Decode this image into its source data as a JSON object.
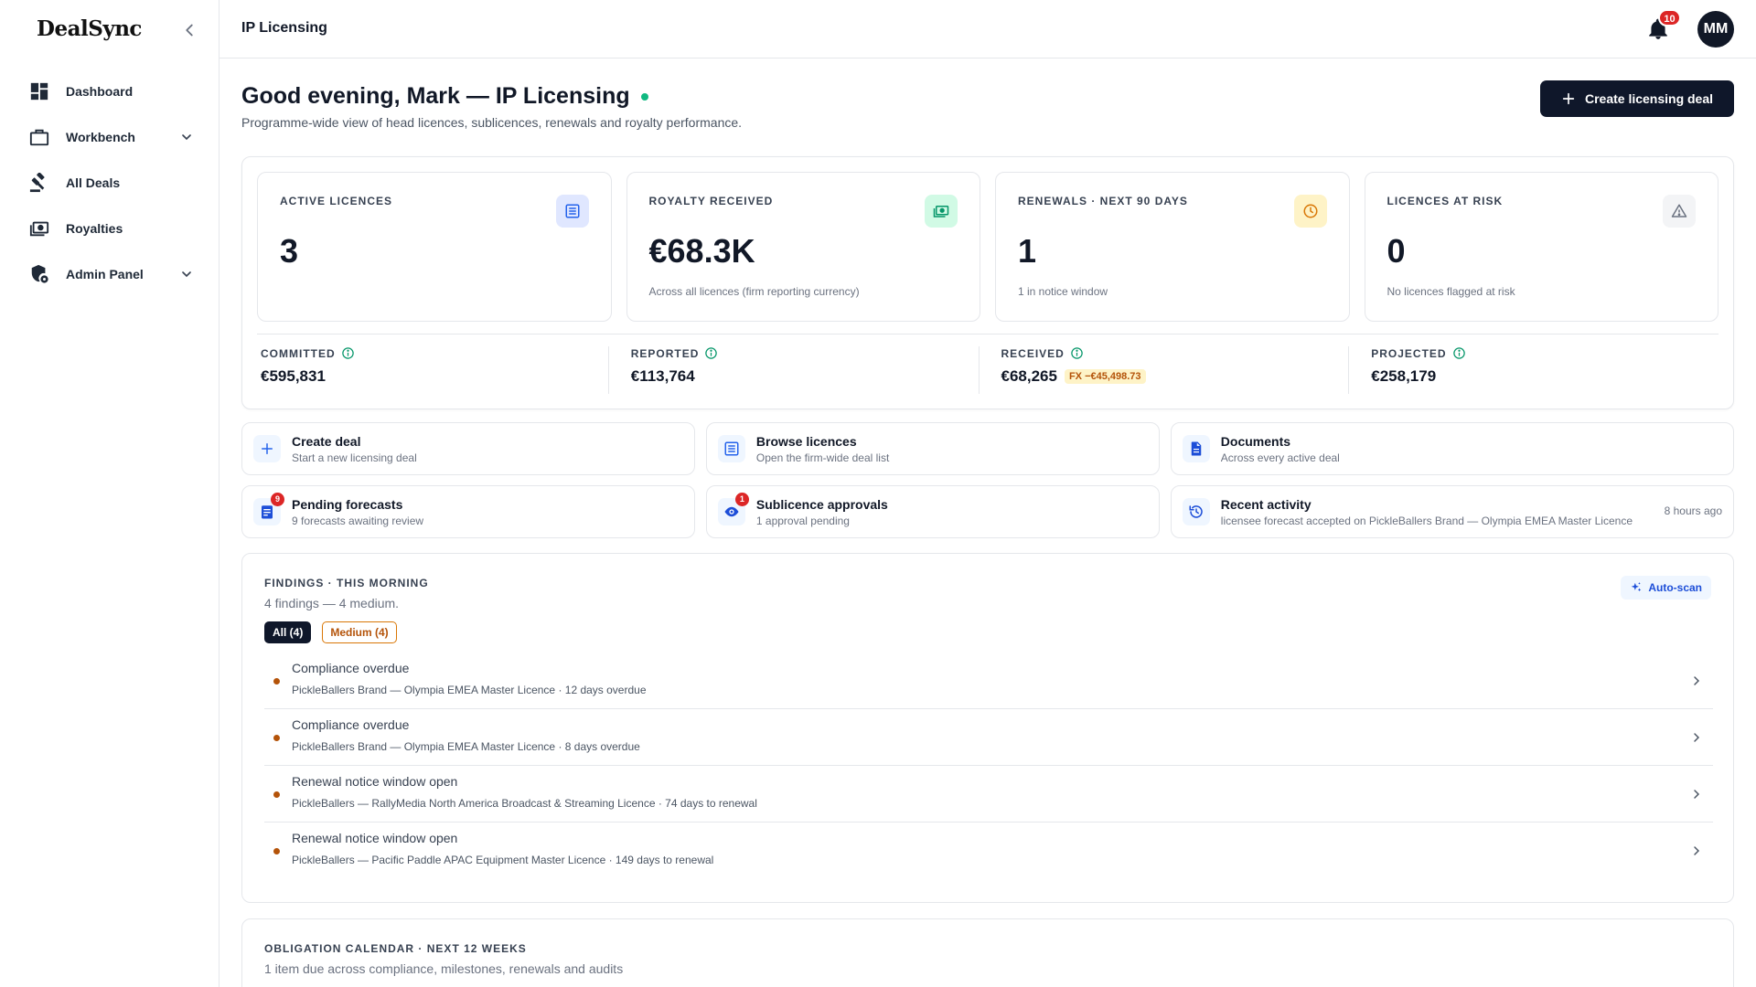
{
  "app": {
    "brand": "DealSync"
  },
  "sidebar": {
    "items": [
      {
        "label": "Dashboard",
        "icon": "dashboard-icon"
      },
      {
        "label": "Workbench",
        "icon": "briefcase-icon",
        "expandable": true
      },
      {
        "label": "All Deals",
        "icon": "gavel-icon"
      },
      {
        "label": "Royalties",
        "icon": "money-icon"
      },
      {
        "label": "Admin Panel",
        "icon": "admin-shield-icon",
        "expandable": true
      }
    ]
  },
  "topbar": {
    "title": "IP Licensing",
    "notifications_count": "10",
    "avatar_initials": "MM"
  },
  "header": {
    "greeting": "Good evening, Mark — IP Licensing",
    "subtitle": "Programme-wide view of head licences, sublicences, renewals and royalty performance.",
    "create_button": "Create licensing deal"
  },
  "kpis": [
    {
      "label": "ACTIVE LICENCES",
      "value": "3",
      "sub": "",
      "icon": "list-icon",
      "color": "#2563eb"
    },
    {
      "label": "ROYALTY RECEIVED",
      "value": "€68.3K",
      "sub": "Across all licences (firm reporting currency)",
      "icon": "cash-icon",
      "color": "#059669"
    },
    {
      "label": "RENEWALS · NEXT 90 DAYS",
      "value": "1",
      "sub": "1 in notice window",
      "icon": "clock-icon",
      "color": "#d97706"
    },
    {
      "label": "LICENCES AT RISK",
      "value": "0",
      "sub": "No licences flagged at risk",
      "icon": "warning-icon",
      "color": "#6b7280"
    }
  ],
  "financials": [
    {
      "label": "COMMITTED",
      "value": "€595,831"
    },
    {
      "label": "REPORTED",
      "value": "€113,764"
    },
    {
      "label": "RECEIVED",
      "value": "€68,265",
      "fx": "FX −€45,498.73"
    },
    {
      "label": "PROJECTED",
      "value": "€258,179"
    }
  ],
  "actions": [
    {
      "title": "Create deal",
      "sub": "Start a new licensing deal",
      "icon": "plus-icon"
    },
    {
      "title": "Browse licences",
      "sub": "Open the firm-wide deal list",
      "icon": "list-icon"
    },
    {
      "title": "Documents",
      "sub": "Across every active deal",
      "icon": "document-icon"
    },
    {
      "title": "Pending forecasts",
      "sub": "9 forecasts awaiting review",
      "icon": "forecast-icon",
      "badge": "9"
    },
    {
      "title": "Sublicence approvals",
      "sub": "1 approval pending",
      "icon": "eye-icon",
      "badge": "1"
    },
    {
      "title": "Recent activity",
      "sub": "licensee forecast accepted on PickleBallers Brand — Olympia EMEA Master Licence",
      "icon": "history-icon",
      "time": "8 hours ago"
    }
  ],
  "findings": {
    "label": "FINDINGS · THIS MORNING",
    "summary": "4 findings — 4 medium.",
    "autoscan": "Auto-scan",
    "filters": {
      "all": "All (4)",
      "medium": "Medium (4)"
    },
    "items": [
      {
        "title": "Compliance overdue",
        "sub": "PickleBallers Brand — Olympia EMEA Master Licence · 12 days overdue",
        "severity": "medium"
      },
      {
        "title": "Compliance overdue",
        "sub": "PickleBallers Brand — Olympia EMEA Master Licence · 8 days overdue",
        "severity": "medium"
      },
      {
        "title": "Renewal notice window open",
        "sub": "PickleBallers — RallyMedia North America Broadcast & Streaming Licence · 74 days to renewal",
        "severity": "medium"
      },
      {
        "title": "Renewal notice window open",
        "sub": "PickleBallers — Pacific Paddle APAC Equipment Master Licence · 149 days to renewal",
        "severity": "medium"
      }
    ]
  },
  "calendar": {
    "label": "OBLIGATION CALENDAR · NEXT 12 WEEKS",
    "summary": "1 item due across compliance, milestones, renewals and audits"
  }
}
